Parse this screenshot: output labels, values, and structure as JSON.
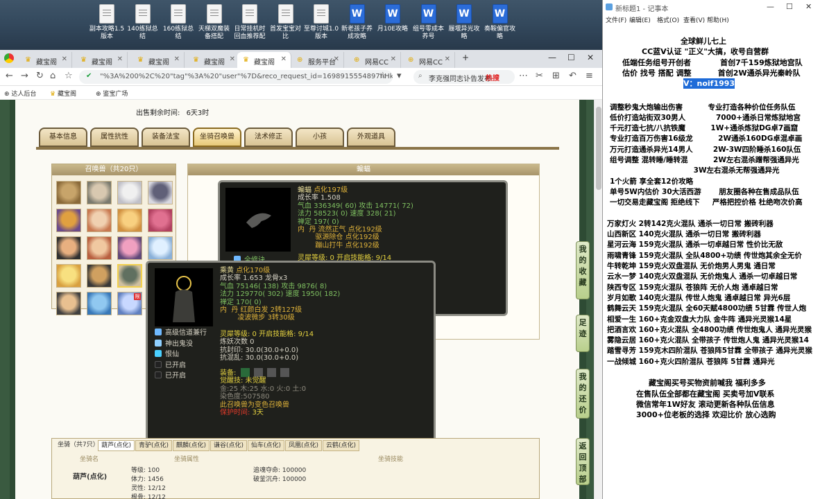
{
  "desktop": {
    "icons": [
      {
        "label": "副本攻略1.5\n版本",
        "type": "txt"
      },
      {
        "label": "140练狱总结",
        "type": "txt"
      },
      {
        "label": "160练狱总结",
        "type": "txt"
      },
      {
        "label": "天梯双魔装\n备搭配",
        "type": "txt"
      },
      {
        "label": "日常挂机时\n回血推荐配",
        "type": "txt"
      },
      {
        "label": "首发宝宝对\n比",
        "type": "txt"
      },
      {
        "label": "至尊讨城1.0\n版本",
        "type": "txt"
      },
      {
        "label": "新老孩子养\n成攻略",
        "type": "doc"
      },
      {
        "label": "月10E攻略",
        "type": "doc"
      },
      {
        "label": "组号零成本\n养号",
        "type": "doc"
      },
      {
        "label": "履堰异光攻\n略",
        "type": "doc"
      },
      {
        "label": "奏鞍偏官攻\n略",
        "type": "doc"
      }
    ]
  },
  "browser": {
    "tabs": [
      {
        "label": "藏宝阁"
      },
      {
        "label": "藏宝阁"
      },
      {
        "label": "藏宝阁"
      },
      {
        "label": "藏宝阁"
      },
      {
        "label": "藏宝阁"
      },
      {
        "label": "服务平台"
      },
      {
        "label": "网易CC"
      },
      {
        "label": "网易CC"
      }
    ],
    "url": "\"%3A%200%2C%20\"tag\"%3A%20\"user\"%7D&reco_request_id=1698915554897hHk8V",
    "search_text": "李克强同志讣告发布",
    "hot_label": "热搜",
    "bookmarks": [
      "达人后台",
      "藏宝阁",
      "鉴宝广场"
    ]
  },
  "game": {
    "price_label": "出售剩余时间:",
    "remain_time": "6天3时",
    "tabs": [
      "基本信息",
      "属性抗性",
      "装备法宝",
      "坐骑召唤兽",
      "法术修正",
      "小孩",
      "外观道具"
    ],
    "summon_header": "召唤兽（共20只）",
    "detail_header": "蝙蝠",
    "popup_bat": {
      "name": "蝙蝠",
      "level": "点化197级",
      "lines": [
        "成长率 1.508",
        "气血 336349( 60) 攻击 14771( 72)",
        "法力 58523( 0) 速度 328( 21)",
        "禅定 197( 0)",
        "内  丹 流然正气 点化192级",
        "        驱源除仓 点化192级",
        "        蹦山打牛 点化192级"
      ],
      "spirit": "灵犀等级: 0 开启技能格: 9/14",
      "skill": "全修诀"
    },
    "popup_tiger": {
      "name": "乘黄",
      "level": "点化170级",
      "lines": [
        "成长率 1.653 龙骨x3",
        "气血 75146( 138) 攻击 9876( 8)",
        "法力 129770( 302) 速度 1950( 182)",
        "禅定 170( 0)",
        "内  丹 红颜白发 2转127级",
        "        凌波微步 3转30级"
      ],
      "skills": [
        "高级信道兼行",
        "神出鬼没",
        "恨仙",
        "已开启",
        "已开启"
      ],
      "spirit": "灵犀等级: 0 开启技能格: 9/14",
      "demon": "炼妖次数 0",
      "resist1": "抗封印: 30.0(30.0+0.0)",
      "resist2": "抗混乱: 30.0(30.0+0.0)",
      "equip_label": "装备:",
      "awaken": "觉醒技: 未觉醒",
      "gem": "金:25 木:25 水:0 火:0 土:0",
      "hue": "染色度:507580",
      "note": "此召唤兽为变色召唤兽",
      "protect_label": "保护时间:",
      "protect_val": "3天"
    },
    "mount": {
      "title": "坐骑（共7只）",
      "tabs": [
        "葫芦(点化)",
        "青驴(点化)",
        "麒麟(点化)",
        "谦谷(点化)",
        "仙车(点化)",
        "凤凰(点化)",
        "云鹤(点化)"
      ],
      "col1": "坐骑名",
      "col2": "坐骑属性",
      "col3": "坐骑技能",
      "name": "葫芦(点化)",
      "attrs": [
        "等级: 100",
        "体力: 1456",
        "灵性: 12/12",
        "根骨: 12/12"
      ],
      "skills": [
        "追魂夺命: 100000",
        "破釜沉舟: 100000"
      ]
    },
    "side_buttons": [
      "我的收藏",
      "足迹",
      "我的还价",
      "返回顶部"
    ]
  },
  "notepad": {
    "title": "新标题1 - 记事本",
    "menu": [
      "文件(F)",
      "编辑(E)",
      "格式(O)",
      "查看(V)",
      "帮助(H)"
    ],
    "lines": [
      "全球鲜儿七上",
      "CC蓝V认证 \"正义\"大搞，收号自营群",
      "低端任务组号开创者           首创7千159炼狱地宫队",
      "估价 找号 搭配 调整          首创2W通杀异光秦岭队",
      "V：noif1993",
      "",
      "调整秒鬼大炮输出伤害          专业打造各种价位任务队伍",
      "低价打造站街双30男人            7000+通杀日常炼狱地宫",
      "千元打造七抗/八抗铁魔          1W+通杀炼狱DG卓7画窟",
      "专业打造百万伤害16级龙          2W通杀160DG卓混卓画",
      "万元打造通杀异光14男人        2W-3W四阶睡杀160队伍",
      "组号调整 混转睡/睡转混          2W左右混杀蹭帮强通异光",
      "                                 3W左右混杀无帮强通异光",
      "1个火箭 享全套12价攻略",
      "单号5W内估价 30大活西游       朋友圈各种在售成品队伍",
      "一切交易走藏宝阁 拒绝线下     严格把控价格 杜绝吻次价高",
      "",
      "万家灯火 2转142克火混队 通杀一切日常 搬砖利器",
      "山西新区 140克火混队 通杀一切日常 搬砖利器",
      "星河云海 159克火混队 通杀一切卓越日常 性价比无敌",
      "雨啸青锋 159克火混队 全队4800+功绩 传世炮其余全无价",
      "牛转乾坤 159克火双盘混队 无价炮男人男鬼 通日常",
      "云水一梦 140克火双盘混队 无价炮鬼人 通杀一切卓越日常",
      "陕西专区 159克火混队 苍狼阵 无价人炮 通卓越日常",
      "岁月如歌 140克火混队 传世人炮鬼 通卓越日常 异光6层",
      "鹤舞云天 159克火混队 全60天赋4800功绩 5甘霖 传世人炮",
      "相爱一生 160+克金双盘大力队 金牛阵 通异光灵猴14星",
      "把酒言欢 160+克火混队 全4800功绩 传世炮鬼人 通异光灵猴",
      "雾隐云居 160+克火混队 全带孩子 传世炮人鬼 通异光灵猴14",
      "踏雪寻芳 159克木四阶混队 苍狼阵5甘霖 全带孩子 通异光灵猴",
      "一战倾城 160+克火四阶混队 苍狼阵 5甘霖 通异光",
      "",
      "藏宝阁买号买物资前喊我 福利多多",
      "在售队伍全部都在藏宝阁 买卖号加V联系",
      "微信常年1W好友 滚动更新各种队伍信息",
      "3000+位老板的选择 欢迎比价 放心选购"
    ]
  },
  "colors": {
    "accent": "#1e6bd8",
    "frame_green": "#3a5a40",
    "tab_gold": "#e8c978",
    "popup_bg": "#1f201c",
    "red": "#e33a2a"
  }
}
